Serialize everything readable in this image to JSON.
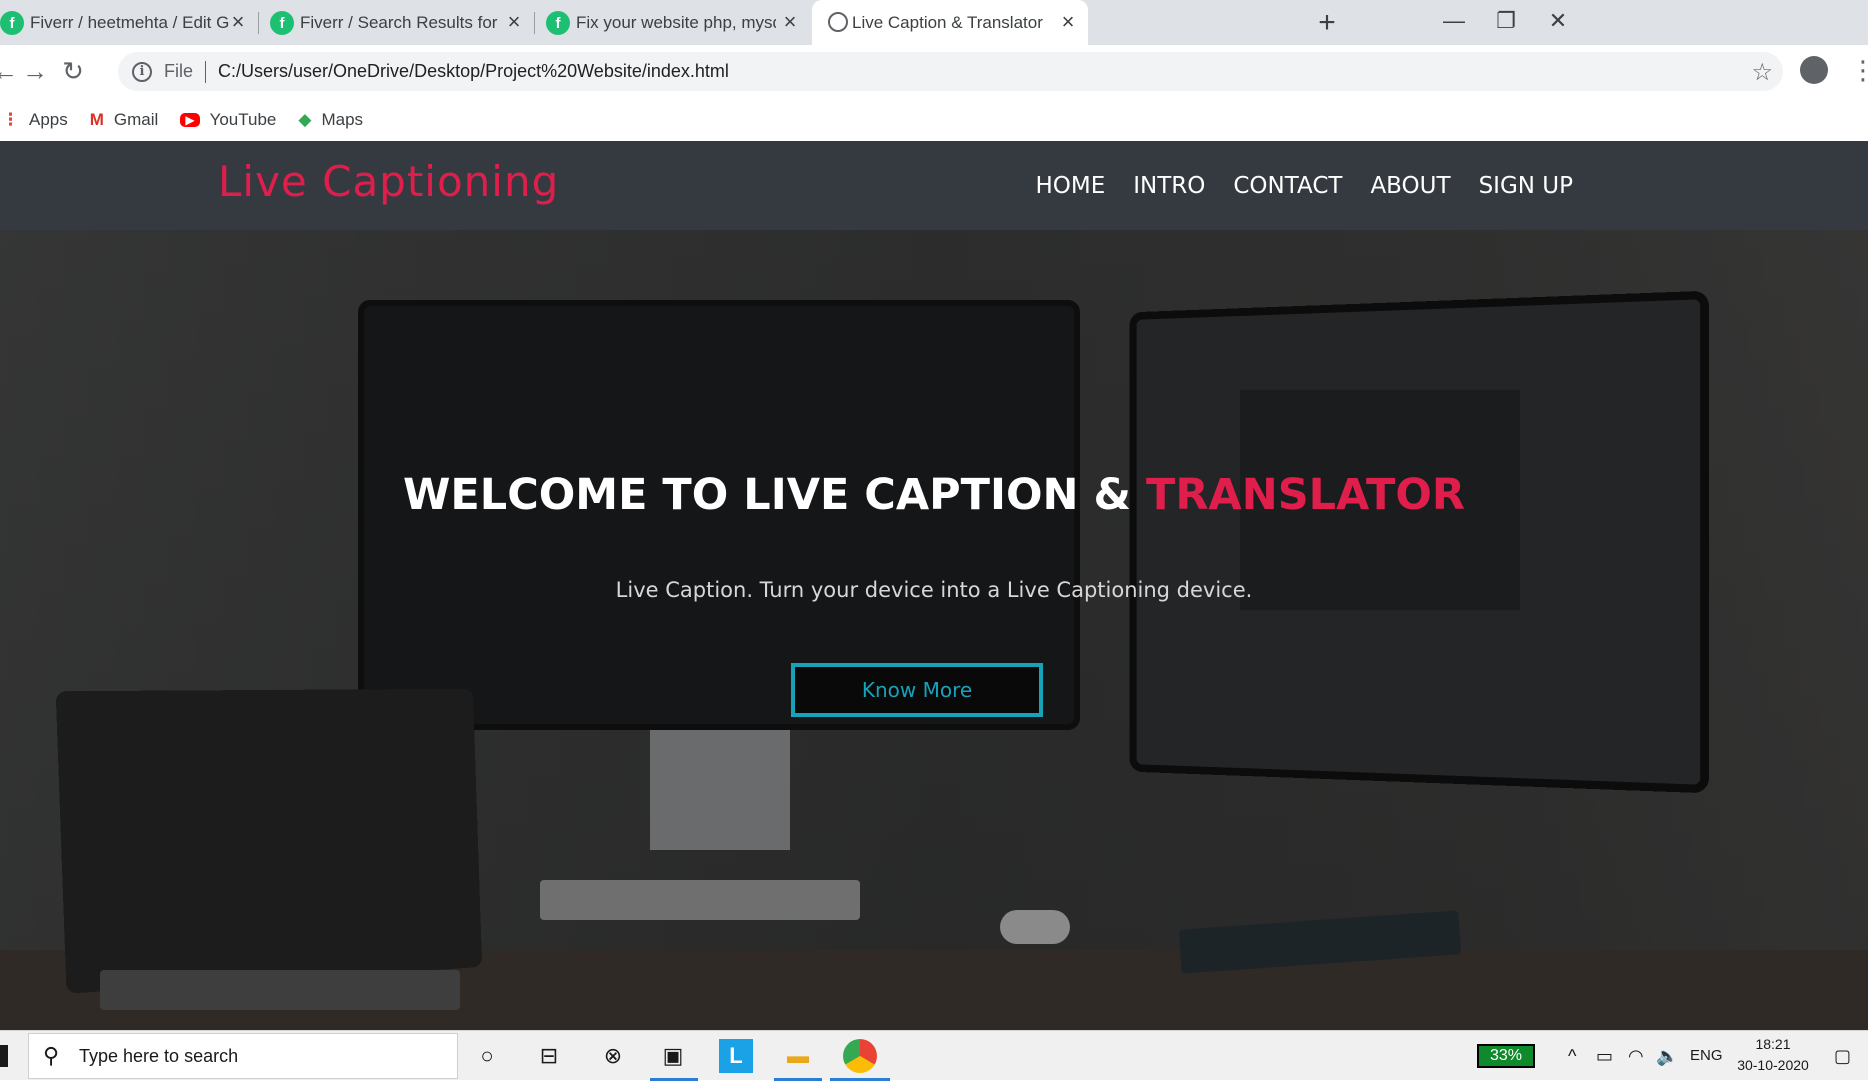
{
  "browser": {
    "tabs": [
      {
        "title": "Fiverr / heetmehta / Edit Gig",
        "favicon": "fiverr-icon"
      },
      {
        "title": "Fiverr / Search Results for 'html e",
        "favicon": "fiverr-icon"
      },
      {
        "title": "Fix your website php, mysql, java",
        "favicon": "fiverr-icon"
      },
      {
        "title": "Live Caption & Translator",
        "favicon": "globe-icon",
        "active": true
      }
    ],
    "new_tab_label": "+",
    "address": {
      "scheme_label": "File",
      "url": "C:/Users/user/OneDrive/Desktop/Project%20Website/index.html"
    },
    "bookmarks": [
      {
        "label": "Apps",
        "icon": "apps-grid-icon"
      },
      {
        "label": "Gmail",
        "icon": "gmail-icon"
      },
      {
        "label": "YouTube",
        "icon": "youtube-icon"
      },
      {
        "label": "Maps",
        "icon": "maps-icon"
      }
    ]
  },
  "site": {
    "brand": "Live Captioning",
    "nav": [
      "HOME",
      "INTRO",
      "CONTACT",
      "ABOUT",
      "SIGN UP"
    ],
    "hero": {
      "title_main": "WELCOME TO LIVE CAPTION & ",
      "title_accent": "TRANSLATOR",
      "subtitle": "Live Caption. Turn your device into a Live Captioning device.",
      "cta": "Know More"
    },
    "colors": {
      "accent": "#e01e4c",
      "cta": "#17a2b8",
      "navbar": "#343a40"
    }
  },
  "taskbar": {
    "search_placeholder": "Type here to search",
    "battery": "33%",
    "language": "ENG",
    "time": "18:21",
    "date": "30-10-2020",
    "app_icons": [
      "cortana-icon",
      "task-view-icon",
      "xbox-icon",
      "store-icon",
      "l-app-icon",
      "file-explorer-icon",
      "chrome-icon"
    ]
  }
}
